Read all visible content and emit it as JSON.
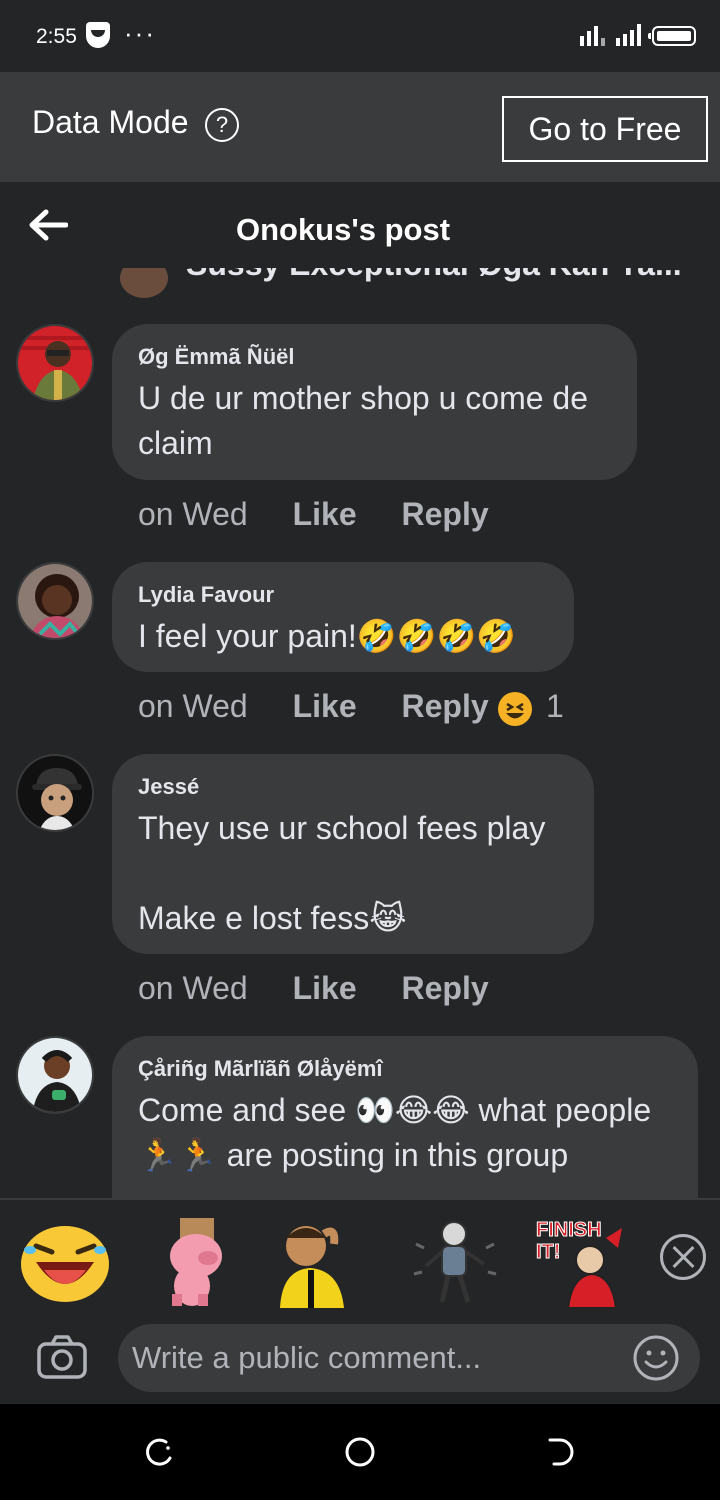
{
  "status_bar": {
    "time": "2:55",
    "dots": "···"
  },
  "data_mode": {
    "title": "Data Mode",
    "help_glyph": "?",
    "button_label": "Go to Free"
  },
  "header": {
    "title": "Onokus's post"
  },
  "clipped_comment": {
    "text": "Sussy Exceptional  Øga Kan Ya..."
  },
  "comments": [
    {
      "author": "Øg Ëmmã Ñüël",
      "text": "U de ur mother shop u come de claim",
      "time": "on Wed",
      "like": "Like",
      "reply": "Reply"
    },
    {
      "author": "Lydia Favour",
      "text": "I feel your pain!🤣🤣🤣🤣",
      "time": "on Wed",
      "like": "Like",
      "reply": "Reply",
      "reaction_count": "1"
    },
    {
      "author": "Jessé",
      "text": "They use ur school fees play\n\nMake e lost fess😹",
      "time": "on Wed",
      "like": "Like",
      "reply": "Reply"
    },
    {
      "author": "Çåriñg Mãrlïãñ Ølåyëmî",
      "text": "Come and see 👀😂😂 what people 🏃🏃 are posting in this group",
      "time": "",
      "like": "",
      "reply": ""
    }
  ],
  "stickers": [
    "laughing-face",
    "pig-with-bag",
    "referee-man",
    "dancing-man",
    "finish-it-man"
  ],
  "composer": {
    "placeholder": "Write a public comment..."
  },
  "colors": {
    "background": "#242526",
    "bubble": "#3a3b3c",
    "secondary_text": "#b0b3b8",
    "primary_text": "#e4e6eb"
  }
}
